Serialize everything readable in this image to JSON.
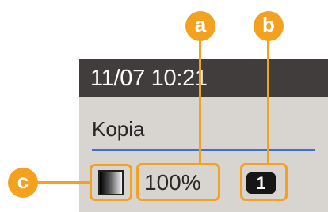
{
  "lcd": {
    "datetime": "11/07 10:21",
    "title": "Kopia",
    "zoom": "100%",
    "copies": "1",
    "density_icon": "density-gradient-icon"
  },
  "callouts": {
    "a": "a",
    "b": "b",
    "c": "c"
  },
  "colors": {
    "accent": "#f4a11f",
    "header_bg": "#403d3c",
    "screen_bg": "#d8d4cf",
    "rule": "#3f6fd4"
  }
}
